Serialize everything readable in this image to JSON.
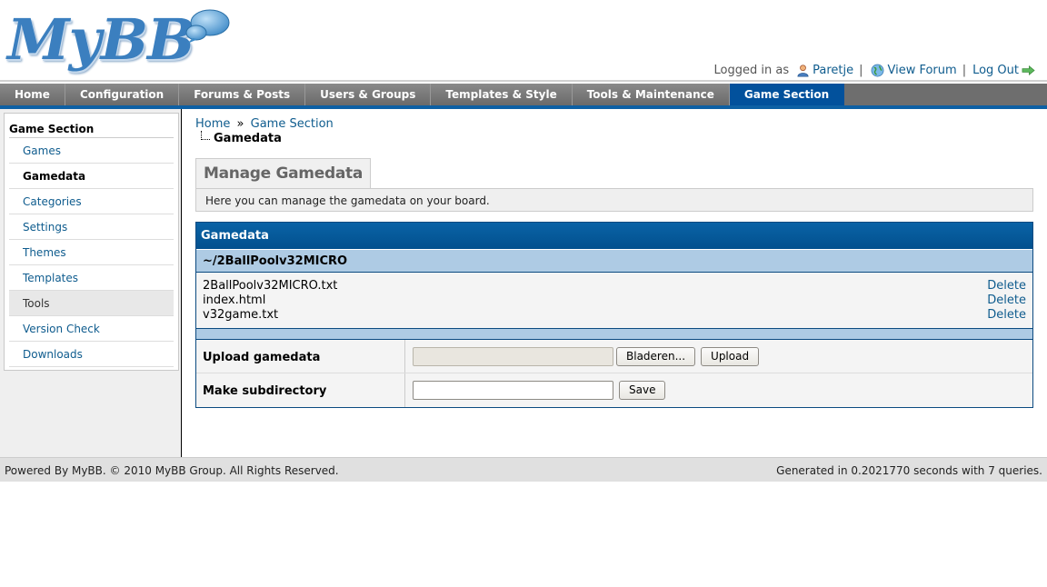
{
  "logo_text": "MyBB",
  "userbar": {
    "logged_in_label": "Logged in as",
    "username": "Paretje",
    "view_forum": "View Forum",
    "logout": "Log Out",
    "separator": "|"
  },
  "menu": {
    "tabs": [
      {
        "label": "Home"
      },
      {
        "label": "Configuration"
      },
      {
        "label": "Forums & Posts"
      },
      {
        "label": "Users & Groups"
      },
      {
        "label": "Templates & Style"
      },
      {
        "label": "Tools & Maintenance"
      },
      {
        "label": "Game Section"
      }
    ],
    "active": "Game Section"
  },
  "sidebar": {
    "title": "Game Section",
    "items": [
      {
        "label": "Games"
      },
      {
        "label": "Gamedata"
      },
      {
        "label": "Categories"
      },
      {
        "label": "Settings"
      },
      {
        "label": "Themes"
      },
      {
        "label": "Templates"
      },
      {
        "label": "Tools"
      },
      {
        "label": "Version Check"
      },
      {
        "label": "Downloads"
      }
    ],
    "current": "Gamedata"
  },
  "breadcrumb": {
    "home": "Home",
    "separator": "»",
    "section": "Game Section"
  },
  "page_title": "Gamedata",
  "tab": {
    "label": "Manage Gamedata",
    "description": "Here you can manage the gamedata on your board."
  },
  "table": {
    "header": "Gamedata",
    "directory": "~/2BallPoolv32MICRO",
    "files": [
      {
        "name": "2BallPoolv32MICRO.txt",
        "action": "Delete"
      },
      {
        "name": "index.html",
        "action": "Delete"
      },
      {
        "name": "v32game.txt",
        "action": "Delete"
      }
    ],
    "upload": {
      "label": "Upload gamedata",
      "browse_button": "Bladeren...",
      "submit_button": "Upload"
    },
    "subdir": {
      "label": "Make subdirectory",
      "value": "",
      "submit_button": "Save"
    }
  },
  "footer": {
    "left": "Powered By MyBB. © 2010 MyBB Group. All Rights Reserved.",
    "right": "Generated in 0.2021770 seconds with 7 queries."
  }
}
